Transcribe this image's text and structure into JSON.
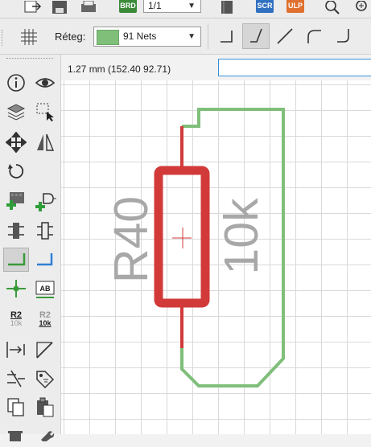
{
  "top_toolbar": {
    "brd_badge": "BRD",
    "sheet_value": "1/1",
    "scr_badge": "SCR",
    "ulp_badge": "ULP"
  },
  "layer_bar": {
    "label": "Réteg:",
    "layer_value": "91 Nets",
    "layer_color": "#7fbf7a"
  },
  "coord_bar": {
    "text": "1.27 mm (152.40 92.71)",
    "command_value": ""
  },
  "tools": {
    "label_tool_r2": "R2",
    "label_tool_10k": "10k",
    "value_tool_r2": "R2",
    "value_tool_10k": "10k",
    "ab_text": "AB"
  },
  "canvas": {
    "part_name": "R40",
    "part_value": "10k",
    "colors": {
      "top_copper": "#d23a3a",
      "net": "#7fbf7a",
      "text": "#a8a8a8",
      "grid": "#d9d9d9"
    }
  }
}
